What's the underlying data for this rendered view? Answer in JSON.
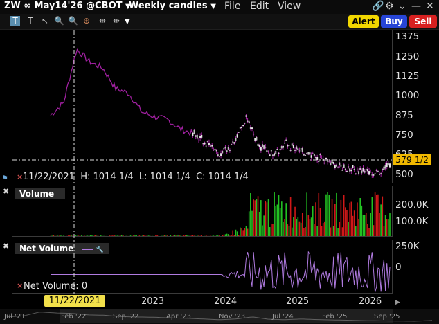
{
  "window": {
    "symbol": "ZW",
    "contract": "∞ May14'26 @CBOT",
    "period": "Weekly candles",
    "menu": {
      "file": "File",
      "edit": "Edit",
      "view": "View"
    }
  },
  "toolbar": {
    "tools": [
      "text-tool-icon",
      "t-tool-icon",
      "cursor-icon",
      "zoom-in-icon",
      "zoom-out-icon",
      "crosshair-icon",
      "split-vertical-icon",
      "split-horizontal-icon"
    ],
    "alert_label": "Alert",
    "buy_label": "Buy",
    "sell_label": "Sell",
    "colors": {
      "alert": "#f2d700",
      "buy": "#2745d6",
      "sell": "#d82020"
    }
  },
  "price_panel": {
    "axis_ticks": [
      "1375",
      "1250",
      "1125",
      "1000",
      "875",
      "750",
      "625",
      "500"
    ],
    "current_price": "579 1/2",
    "info": {
      "date": "11/22/2021",
      "high": "H: 1014 1/4",
      "low": "L: 1014 1/4",
      "close": "C: 1014 1/4"
    }
  },
  "volume_panel": {
    "title": "Volume",
    "axis_ticks": [
      "200.0K",
      "100.0K"
    ]
  },
  "netvol_panel": {
    "title": "Net Volume",
    "axis_ticks": [
      "250K",
      "0"
    ],
    "legend_label": "Net Volume:",
    "legend_value": "0"
  },
  "crosshair_date": "11/22/2021",
  "x_axis": [
    "2023",
    "2024",
    "2025",
    "2026"
  ],
  "scroller_labels": [
    "Jul '21",
    "Feb '22",
    "Sep '22",
    "Apr '23",
    "Nov '23",
    "Jul '24",
    "Feb '25",
    "Sep '25"
  ],
  "colors": {
    "price_line": "#a020a0",
    "candle": "#e6e6e6",
    "vol_up": "#22c022",
    "vol_down": "#d01818",
    "netvol": "#b07be0",
    "highlight": "#f0b800"
  },
  "chart_data": [
    {
      "type": "line",
      "title": "ZW ∞ May14'26 @CBOT",
      "x": [
        "2021-11",
        "2022-01",
        "2022-03",
        "2022-05",
        "2022-07",
        "2022-09",
        "2022-11",
        "2023-01",
        "2023-03",
        "2023-05",
        "2023-07",
        "2023-09",
        "2023-11",
        "2024-01",
        "2024-03",
        "2024-05",
        "2024-07",
        "2024-09",
        "2024-11",
        "2025-01",
        "2025-03",
        "2025-05",
        "2025-07",
        "2025-09",
        "2025-11",
        "2026-01",
        "2026-03"
      ],
      "series": [
        {
          "values": [
            880,
            960,
            1300,
            1220,
            1180,
            1050,
            1020,
            900,
            870,
            850,
            790,
            760,
            700,
            640,
            700,
            880,
            680,
            640,
            700,
            650,
            620,
            590,
            560,
            540,
            525,
            510,
            580
          ]
        }
      ],
      "ylim": [
        450,
        1420
      ]
    },
    {
      "type": "bar",
      "title": "Volume",
      "ylim": [
        0,
        260000
      ]
    },
    {
      "type": "line",
      "title": "Net Volume",
      "ylim": [
        -150000,
        280000
      ]
    }
  ]
}
